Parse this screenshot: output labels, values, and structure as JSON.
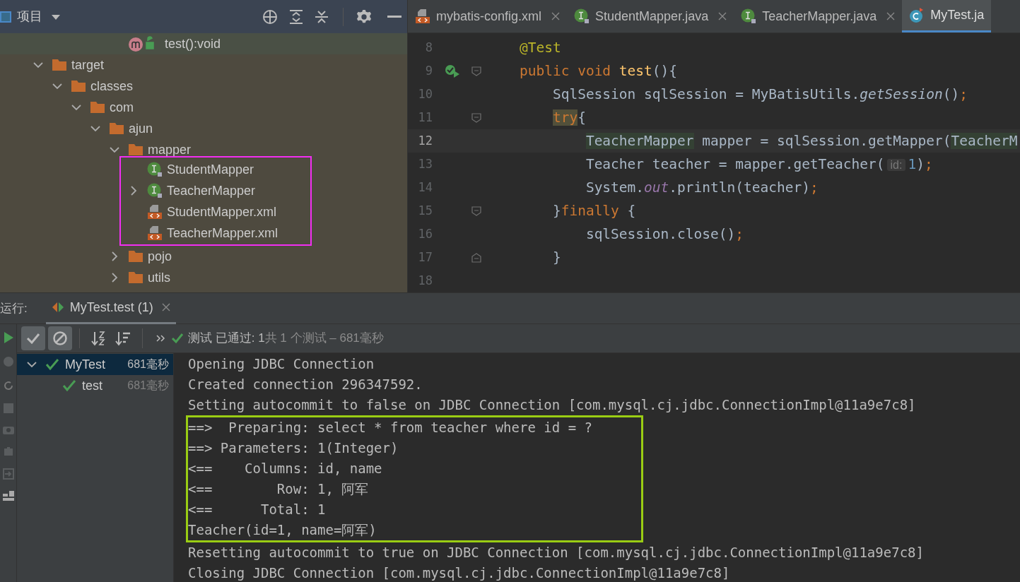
{
  "project_panel": {
    "title": "项目",
    "method_row": {
      "label": "test():void"
    },
    "tree": [
      {
        "label": "target",
        "kind": "folder",
        "expanded": true,
        "children": [
          {
            "label": "classes",
            "kind": "folder",
            "expanded": true,
            "children": [
              {
                "label": "com",
                "kind": "folder",
                "expanded": true,
                "children": [
                  {
                    "label": "ajun",
                    "kind": "folder",
                    "expanded": true,
                    "children": [
                      {
                        "label": "mapper",
                        "kind": "folder",
                        "expanded": true,
                        "outlined": true,
                        "children": [
                          {
                            "label": "StudentMapper",
                            "kind": "interface"
                          },
                          {
                            "label": "TeacherMapper",
                            "kind": "interface",
                            "expanded": false
                          },
                          {
                            "label": "StudentMapper.xml",
                            "kind": "xml"
                          },
                          {
                            "label": "TeacherMapper.xml",
                            "kind": "xml"
                          }
                        ]
                      },
                      {
                        "label": "pojo",
                        "kind": "folder",
                        "expanded": false
                      },
                      {
                        "label": "utils",
                        "kind": "folder",
                        "expanded": false
                      }
                    ]
                  }
                ]
              }
            ]
          }
        ]
      }
    ]
  },
  "editor": {
    "tabs": [
      {
        "label": "mybatis-config.xml",
        "kind": "xml",
        "selected": false
      },
      {
        "label": "StudentMapper.java",
        "kind": "interface",
        "selected": false
      },
      {
        "label": "TeacherMapper.java",
        "kind": "interface",
        "selected": false
      },
      {
        "label": "MyTest.ja",
        "kind": "class",
        "selected": true
      }
    ],
    "lines": [
      {
        "number": "8",
        "current": false,
        "run_marker": false,
        "fold_open": false,
        "fold_close": false,
        "tokens": [
          {
            "t": "    @Test",
            "kind": "annotation"
          }
        ]
      },
      {
        "number": "9",
        "current": false,
        "run_marker": true,
        "fold_open": true,
        "fold_close": false,
        "tokens": [
          {
            "t": "    public void ",
            "kind": "keyword"
          },
          {
            "t": "test",
            "kind": "method"
          },
          {
            "t": "(){",
            "kind": "plain"
          }
        ]
      },
      {
        "number": "10",
        "current": false,
        "run_marker": false,
        "fold_open": false,
        "fold_close": false,
        "tokens": [
          {
            "t": "        SqlSession sqlSession = MyBatisUtils.",
            "kind": "plain"
          },
          {
            "t": "getSession",
            "kind": "static"
          },
          {
            "t": "()",
            "kind": "plain"
          },
          {
            "t": ";",
            "kind": "keyword"
          }
        ]
      },
      {
        "number": "11",
        "current": false,
        "run_marker": false,
        "fold_open": true,
        "fold_close": false,
        "tokens": [
          {
            "t": "        try",
            "kind": "keyword-match"
          },
          {
            "t": "{",
            "kind": "plain"
          }
        ]
      },
      {
        "number": "12",
        "current": true,
        "run_marker": false,
        "fold_open": false,
        "fold_close": false,
        "tokens": [
          {
            "t": "            TeacherMapper",
            "kind": "usage"
          },
          {
            "t": " mapper = sqlSession.getMapper(",
            "kind": "plain"
          },
          {
            "t": "TeacherM",
            "kind": "usage"
          }
        ]
      },
      {
        "number": "13",
        "current": false,
        "run_marker": false,
        "fold_open": false,
        "fold_close": false,
        "tokens": [
          {
            "t": "            Teacher teacher = mapper.getTeacher(",
            "kind": "plain"
          },
          {
            "t": "id:",
            "kind": "hint"
          },
          {
            "t": "1",
            "kind": "number"
          },
          {
            "t": ")",
            "kind": "plain"
          },
          {
            "t": ";",
            "kind": "keyword"
          }
        ]
      },
      {
        "number": "14",
        "current": false,
        "run_marker": false,
        "fold_open": false,
        "fold_close": false,
        "tokens": [
          {
            "t": "            System.",
            "kind": "plain"
          },
          {
            "t": "out",
            "kind": "field"
          },
          {
            "t": ".println(teacher)",
            "kind": "plain"
          },
          {
            "t": ";",
            "kind": "keyword"
          }
        ]
      },
      {
        "number": "15",
        "current": false,
        "run_marker": false,
        "fold_open": true,
        "fold_close": false,
        "tokens": [
          {
            "t": "        }",
            "kind": "plain"
          },
          {
            "t": "finally ",
            "kind": "keyword"
          },
          {
            "t": "{",
            "kind": "plain"
          }
        ]
      },
      {
        "number": "16",
        "current": false,
        "run_marker": false,
        "fold_open": false,
        "fold_close": false,
        "tokens": [
          {
            "t": "            sqlSession.close()",
            "kind": "plain"
          },
          {
            "t": ";",
            "kind": "keyword"
          }
        ]
      },
      {
        "number": "17",
        "current": false,
        "run_marker": false,
        "fold_open": false,
        "fold_close": true,
        "tokens": [
          {
            "t": "        }",
            "kind": "plain"
          }
        ]
      },
      {
        "number": "18",
        "current": false,
        "run_marker": false,
        "fold_open": false,
        "fold_close": false
      }
    ]
  },
  "run_panel": {
    "label": "运行:",
    "tab": {
      "label": "MyTest.test (1)",
      "selected": true
    },
    "toggles": [
      {
        "kind": "passed",
        "on": true
      },
      {
        "kind": "ignored",
        "on": true
      }
    ],
    "status": {
      "main": "测试 已通过: 1",
      "detail": "共 1 个测试 – 681毫秒"
    },
    "tests": [
      {
        "label": "MyTest",
        "time": "681毫秒",
        "passed": true,
        "selected": true,
        "expanded": true,
        "children": [
          {
            "label": "test",
            "time": "681毫秒",
            "passed": true,
            "selected": false
          }
        ]
      }
    ],
    "console": [
      {
        "text": "Opening JDBC Connection",
        "outlined": false
      },
      {
        "text": "Created connection 296347592.",
        "outlined": false
      },
      {
        "text": "Setting autocommit to false on JDBC Connection [com.mysql.cj.jdbc.ConnectionImpl@11a9e7c8]",
        "outlined": false
      },
      {
        "text": "==>  Preparing: select * from teacher where id = ?",
        "outlined": true
      },
      {
        "text": "==> Parameters: 1(Integer)",
        "outlined": true
      },
      {
        "text": "<==    Columns: id, name",
        "outlined": true
      },
      {
        "text": "<==        Row: 1, 阿军",
        "outlined": true
      },
      {
        "text": "<==      Total: 1",
        "outlined": true
      },
      {
        "text": "Teacher(id=1, name=阿军)",
        "outlined": true
      },
      {
        "text": "Resetting autocommit to true on JDBC Connection [com.mysql.cj.jdbc.ConnectionImpl@11a9e7c8]",
        "outlined": false
      },
      {
        "text": "Closing JDBC Connection [com.mysql.cj.jdbc.ConnectionImpl@11a9e7c8]",
        "outlined": false
      }
    ]
  }
}
